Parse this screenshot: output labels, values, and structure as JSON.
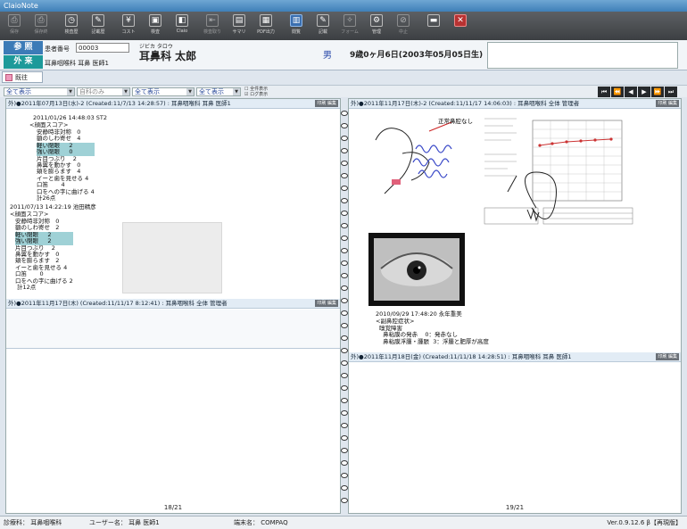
{
  "window": {
    "title": "ClaioNote"
  },
  "toolbar": [
    {
      "label": "保存",
      "icon": "save-icon",
      "dim": true
    },
    {
      "label": "保存終",
      "icon": "save-close-icon",
      "dim": true
    },
    {
      "label": "検査歴",
      "icon": "history-icon",
      "dim": false
    },
    {
      "label": "記載歴",
      "icon": "record-history-icon",
      "dim": false
    },
    {
      "label": "コスト",
      "icon": "cost-icon",
      "dim": false
    },
    {
      "label": "検査",
      "icon": "exam-icon",
      "dim": false
    },
    {
      "label": "Claio",
      "icon": "claio-icon",
      "dim": false
    },
    {
      "label": "検査取り",
      "icon": "import-icon",
      "dim": true
    },
    {
      "label": "サマリ",
      "icon": "summary-icon",
      "dim": false
    },
    {
      "label": "PDF出力",
      "icon": "pdf-icon",
      "dim": false
    },
    {
      "label": "閲覧",
      "icon": "book-icon",
      "dim": false,
      "active": true
    },
    {
      "label": "記載",
      "icon": "pen-icon",
      "dim": false
    },
    {
      "label": "フォーム",
      "icon": "wrench-icon",
      "dim": true
    },
    {
      "label": "管理",
      "icon": "gear-icon",
      "dim": false
    },
    {
      "label": "中止",
      "icon": "cancel-icon",
      "dim": true
    },
    {
      "label": "",
      "icon": "minimize-icon",
      "dim": false
    },
    {
      "label": "",
      "icon": "close-icon",
      "dim": false,
      "red": true
    }
  ],
  "patient": {
    "tag_ref": "参 照",
    "tag_out": "外 来",
    "id_label": "患者番号",
    "id_value": "00003",
    "department": "耳鼻咽喉科  耳鼻  医師1",
    "kana": "ジビカ タロウ",
    "name": "耳鼻科  太郎",
    "sex": "男",
    "age": "9歳0ヶ月6日(2003年05月05日生)"
  },
  "history_tab": "既往",
  "filters": [
    {
      "value": "全て表示",
      "color": "#2a4a9a"
    },
    {
      "value": "自科のみ",
      "color": "#888888"
    },
    {
      "value": "全て表示",
      "color": "#2a4a9a"
    },
    {
      "value": "全て表示",
      "color": "#2a4a9a"
    }
  ],
  "filter_checks": [
    "全件表示",
    "ログ表示"
  ],
  "nav": [
    "⏮",
    "⏪",
    "◀",
    "▶",
    "⏩",
    "⏭"
  ],
  "left_page": {
    "records": [
      {
        "header": "外)●2011年07月13日(水)-2 (Created:11/7/13 14:28:57) : 耳鼻咽喉科 耳鼻 医師1",
        "button": "印刷 編集"
      },
      {
        "header": "外)●2011年11月17日(木) (Created:11/11/17 8:12:41) : 耳鼻咽喉科 全体  管理者",
        "button": "印刷 編集"
      }
    ],
    "entry1_date": "2011/01/26 14:48:03 ST2",
    "entry1_title": "<顔面スコア>",
    "entry1_items": [
      "安静時非対称   0",
      "額のしわ寄せ   4",
      "軽い閉眼     2",
      "強い閉眼     0",
      "片目つぶり    2",
      "鼻翼を動かす   0",
      "頬を膨らます   4",
      "イーと歯を見せる 4",
      "口笛       4",
      "口をへの字に曲げる 4"
    ],
    "entry1_total": "計26点",
    "entry2_date": "2011/07/13 14:22:19 池田精彦",
    "entry2_title": "<顔面スコア>",
    "entry2_items": [
      "安静時非対称   0",
      "額のしわ寄せ   2",
      "軽い閉眼     2",
      "強い閉眼     2",
      "片目つぶり    2",
      "鼻翼を動かす   0",
      "頬を膨らます   2",
      "イーと歯を見せる 4",
      "口笛       0",
      "口をへの字に曲げる 2"
    ],
    "entry2_total": "計12点",
    "page_number": "18/21"
  },
  "right_page": {
    "records": [
      {
        "header": "外)●2011年11月17日(木)-2 (Created:11/11/17 14:06:03) : 耳鼻咽喉科 全体  管理者",
        "button": "印刷 編集"
      },
      {
        "header": "外)●2011年11月18日(金) (Created:11/11/18 14:28:51) : 耳鼻咽喉科 耳鼻 医師1",
        "button": "印刷 編集"
      }
    ],
    "sketch_label": "正常鼻腔なし",
    "audio_line": "2010/09/29 17:48:20 永年重美",
    "audio_title": "<副鼻腔症状>",
    "audio_items": [
      "嗅覚障害",
      "  鼻粘膜の発赤    0：発赤なし",
      "  鼻粘膜浮腫・腫脹  3：浮腫と肥厚が高度"
    ],
    "page_number": "19/21"
  },
  "status": {
    "department": "診療科： 耳鼻咽喉科",
    "user": "ユーザー名： 耳鼻  医師1",
    "terminal": "端末名：  COMPAQ",
    "version": "Ver.0.9.12.6 β【再現版】"
  }
}
